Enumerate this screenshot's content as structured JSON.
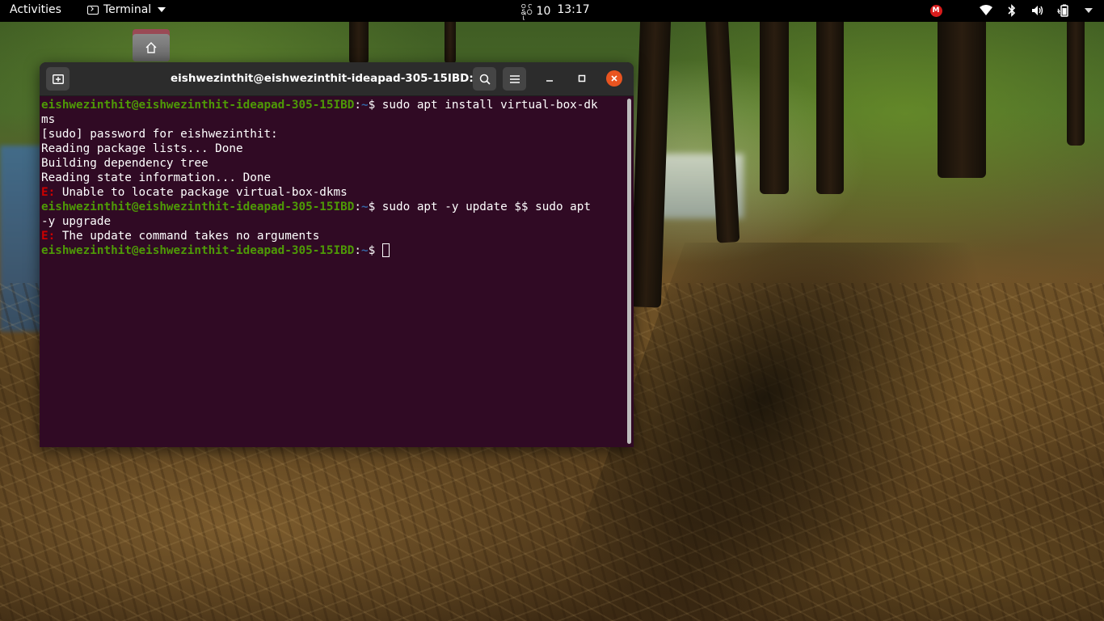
{
  "topbar": {
    "activities": "Activities",
    "app_menu_label": "Terminal",
    "date": "နိုဝ် 10",
    "time": "13:17",
    "mail_badge": "M"
  },
  "terminal": {
    "title": "eishwezinthit@eishwezinthit-ideapad-305-15IBD: ~",
    "prompt_user": "eishwezinthit@eishwezinthit-ideapad-305-15IBD",
    "prompt_path": "~",
    "prompt_suffix": "$ ",
    "lines": [
      {
        "type": "prompt",
        "cmd": "sudo apt install virtual-box-dk"
      },
      {
        "type": "text",
        "text": "ms"
      },
      {
        "type": "text",
        "text": "[sudo] password for eishwezinthit:"
      },
      {
        "type": "text",
        "text": "Reading package lists... Done"
      },
      {
        "type": "text",
        "text": "Building dependency tree"
      },
      {
        "type": "text",
        "text": "Reading state information... Done"
      },
      {
        "type": "error",
        "prefix": "E: ",
        "text": "Unable to locate package virtual-box-dkms"
      },
      {
        "type": "prompt",
        "cmd": "sudo apt -y update $$ sudo apt"
      },
      {
        "type": "text",
        "text": "-y upgrade"
      },
      {
        "type": "error",
        "prefix": "E: ",
        "text": "The update command takes no arguments"
      },
      {
        "type": "prompt",
        "cmd": "",
        "cursor": true
      }
    ]
  },
  "colors": {
    "terminal_bg": "#300a24",
    "prompt_user": "#4e9a06",
    "prompt_path": "#3465a4",
    "error": "#cc0000",
    "close_button": "#e95420"
  },
  "icons": [
    "terminal-icon",
    "home-folder-icon",
    "new-tab-icon",
    "search-icon",
    "hamburger-menu-icon",
    "minimize-icon",
    "maximize-icon",
    "close-icon",
    "wifi-icon",
    "bluetooth-icon",
    "volume-icon",
    "battery-icon",
    "chevron-down-icon"
  ]
}
